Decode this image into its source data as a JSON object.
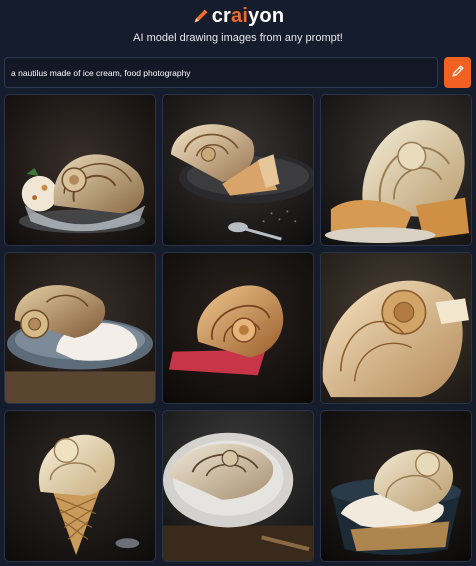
{
  "header": {
    "logo_prefix": "cr",
    "logo_accent": "ai",
    "logo_suffix": "yon",
    "tagline": "AI model drawing images from any prompt!"
  },
  "prompt": {
    "value": "a nautilus made of ice cream, food photography",
    "button_icon": "pencil-icon"
  },
  "colors": {
    "background": "#151c2c",
    "accent": "#f26122"
  },
  "results": {
    "count": 9,
    "images": [
      {
        "name": "nautilus ice cream scoop in glass bowl"
      },
      {
        "name": "nautilus shell on plate with cone"
      },
      {
        "name": "large cream nautilus with wafer"
      },
      {
        "name": "nautilus on vanilla scoop on blue plate"
      },
      {
        "name": "wafer nautilus on red napkin"
      },
      {
        "name": "ribbed cream nautilus close-up"
      },
      {
        "name": "nautilus soft serve in waffle cone"
      },
      {
        "name": "nautilus dessert on plate"
      },
      {
        "name": "nautilus ice cream in bowl"
      }
    ]
  }
}
